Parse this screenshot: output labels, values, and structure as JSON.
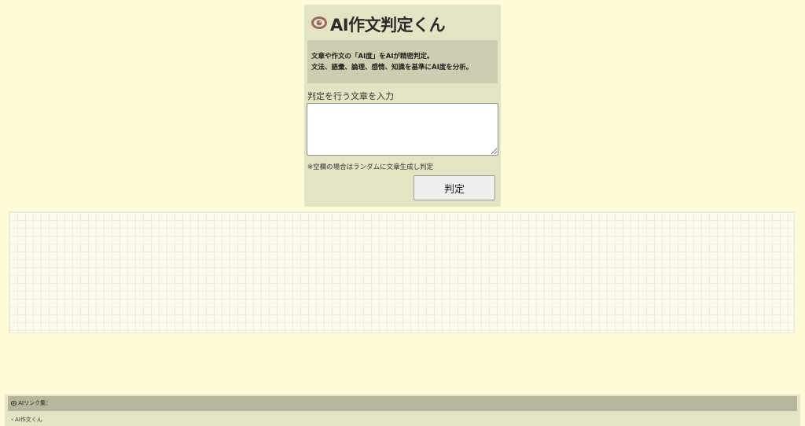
{
  "app": {
    "title": "AI作文判定くん",
    "description_line1": "文章や作文の「AI度」をAIが精密判定。",
    "description_line2": "文法、語彙、論理、感情、知識を基準にAI度を分析。"
  },
  "form": {
    "input_label": "判定を行う文章を入力",
    "textarea_value": "",
    "hint": "※空欄の場合はランダムに文章生成し判定",
    "submit_label": "判定"
  },
  "footer": {
    "header": "AIリンク集：",
    "links": [
      "・AI作文くん"
    ]
  },
  "icons": {
    "title_icon": "eye-icon",
    "footer_icon": "link-icon"
  },
  "colors": {
    "page_background": "#fdfbd8",
    "panel_background": "#e4e3c3",
    "description_background": "#cfcdaf",
    "footer_header_background": "#b7b59c",
    "eye_icon": "#9a6a5f"
  }
}
